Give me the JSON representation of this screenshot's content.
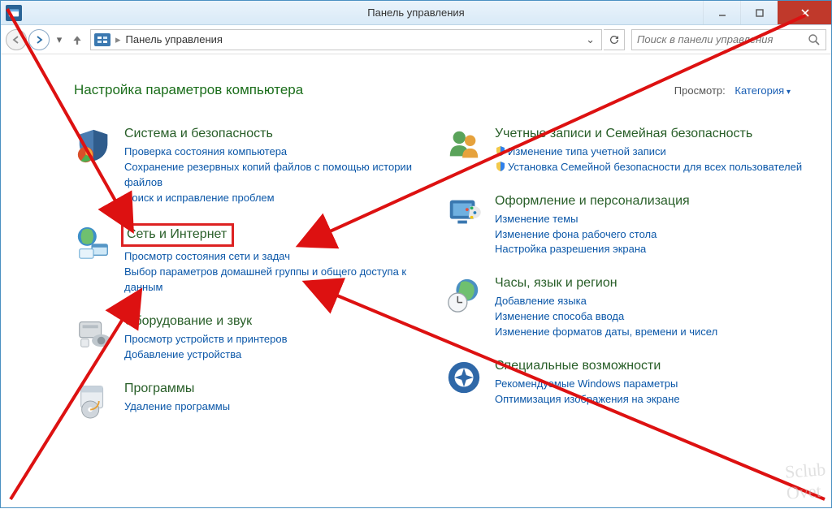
{
  "window": {
    "title": "Панель управления"
  },
  "address": {
    "text": "Панель управления"
  },
  "search": {
    "placeholder": "Поиск в панели управления"
  },
  "heading": "Настройка параметров компьютера",
  "viewby": {
    "label": "Просмотр:",
    "value": "Категория"
  },
  "categories": {
    "system": {
      "title": "Система и безопасность",
      "links": [
        "Проверка состояния компьютера",
        "Сохранение резервных копий файлов с помощью истории файлов",
        "Поиск и исправление проблем"
      ]
    },
    "network": {
      "title": "Сеть и Интернет",
      "links": [
        "Просмотр состояния сети и задач",
        "Выбор параметров домашней группы и общего доступа к данным"
      ]
    },
    "hardware": {
      "title": "Оборудование и звук",
      "links": [
        "Просмотр устройств и принтеров",
        "Добавление устройства"
      ]
    },
    "programs": {
      "title": "Программы",
      "links": [
        "Удаление программы"
      ]
    },
    "users": {
      "title": "Учетные записи и Семейная безопасность",
      "links": [
        "Изменение типа учетной записи",
        "Установка Семейной безопасности для всех пользователей"
      ]
    },
    "appearance": {
      "title": "Оформление и персонализация",
      "links": [
        "Изменение темы",
        "Изменение фона рабочего стола",
        "Настройка разрешения экрана"
      ]
    },
    "clock": {
      "title": "Часы, язык и регион",
      "links": [
        "Добавление языка",
        "Изменение способа ввода",
        "Изменение форматов даты, времени и чисел"
      ]
    },
    "ease": {
      "title": "Специальные возможности",
      "links": [
        "Рекомендуемые Windows параметры",
        "Оптимизация изображения на экране"
      ]
    }
  },
  "watermark": "Sclub\nOvet"
}
